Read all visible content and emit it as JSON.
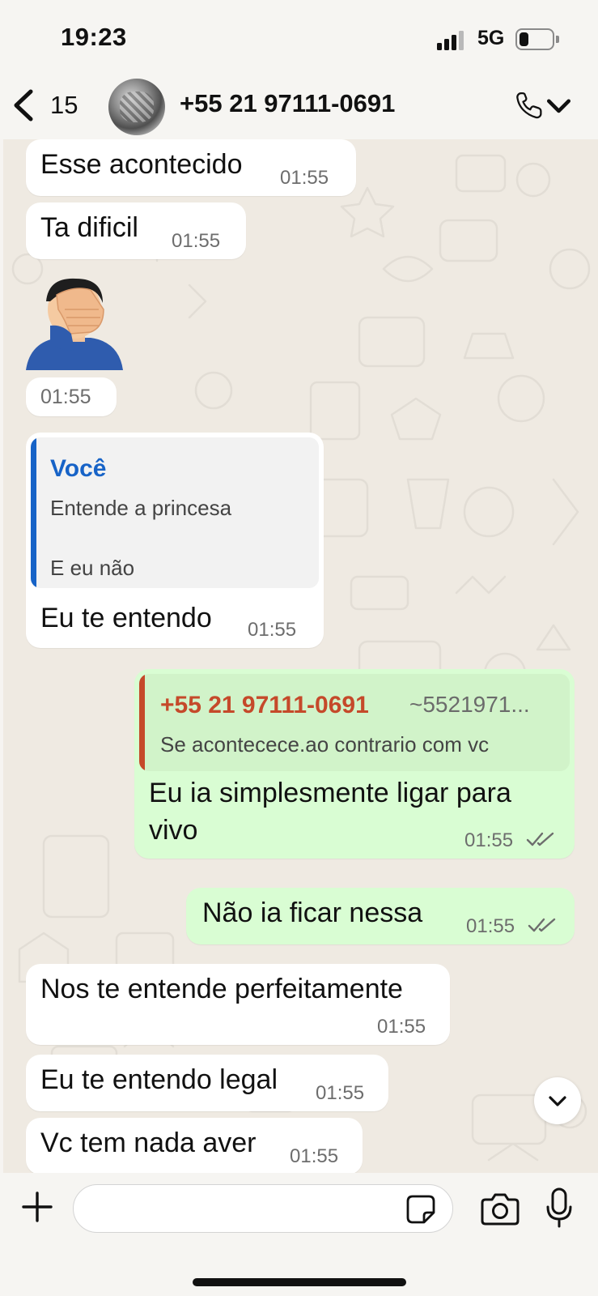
{
  "status_bar": {
    "time": "19:23",
    "network": "5G",
    "battery_level": 0.3,
    "signal_bars": 3
  },
  "header": {
    "back_count": "15",
    "contact_name": "+55 21 97111-0691",
    "back_icon": "chevron-left-icon",
    "call_icon": "phone-icon"
  },
  "messages": [
    {
      "dir": "in",
      "text": "Esse acontecido",
      "time": "01:55"
    },
    {
      "dir": "in",
      "text": "Ta dificil",
      "time": "01:55"
    },
    {
      "dir": "in",
      "sticker": "facepalm-emoji",
      "time": "01:55"
    },
    {
      "dir": "in",
      "quote_author": "Você",
      "quote_line1": "Entende a princesa",
      "quote_line2": "E eu não",
      "text": "Eu te entendo",
      "time": "01:55"
    },
    {
      "dir": "out",
      "quote_author": "+55 21 97111-0691",
      "quote_sub": "~5521971...",
      "quote_line1": "Se acontecece.ao contrario com vc",
      "text_line1": "Eu ia simplesmente ligar para",
      "text_line2": "vivo",
      "time": "01:55",
      "status": "read"
    },
    {
      "dir": "out",
      "text": "Não ia ficar nessa",
      "time": "01:55",
      "status": "read"
    },
    {
      "dir": "in",
      "text": "Nos te entende perfeitamente",
      "time": "01:55"
    },
    {
      "dir": "in",
      "text": "Eu te entendo legal",
      "time": "01:55"
    },
    {
      "dir": "in",
      "text": "Vc tem nada aver",
      "time": "01:55"
    }
  ],
  "composer": {
    "placeholder": "",
    "plus_icon": "plus-icon",
    "sticker_icon": "sticker-icon",
    "camera_icon": "camera-icon",
    "mic_icon": "microphone-icon"
  },
  "colors": {
    "outgoing_bubble": "#d9fdd3",
    "incoming_bubble": "#ffffff",
    "quote_self_accent": "#1763c7",
    "quote_contact_accent": "#c5492a",
    "read_ticks": "#6d6d6d"
  }
}
